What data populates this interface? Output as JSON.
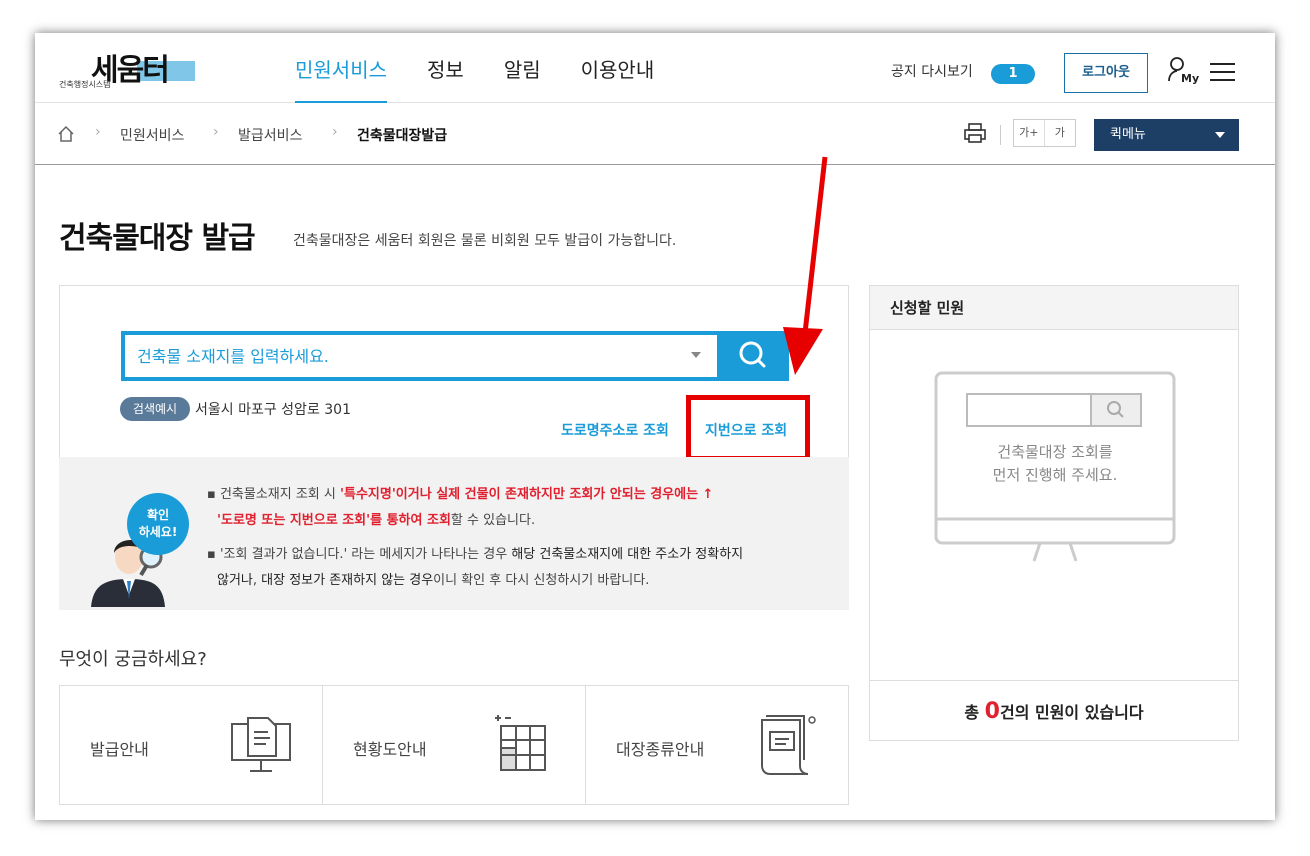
{
  "header": {
    "logo_text": "세움터",
    "logo_sub": "건축행정시스템",
    "nav": [
      {
        "label": "민원서비스"
      },
      {
        "label": "정보"
      },
      {
        "label": "알림"
      },
      {
        "label": "이용안내"
      }
    ],
    "notice_label": "공지 다시보기",
    "notice_count": "1",
    "logout_label": "로그아웃",
    "my_label": "My"
  },
  "breadcrumb": {
    "items": [
      "민원서비스",
      "발급서비스",
      "건축물대장발급"
    ]
  },
  "toolbar": {
    "font_up": "가+",
    "font_down": "가",
    "quick_menu": "퀵메뉴"
  },
  "page": {
    "title": "건축물대장 발급",
    "desc": "건축물대장은 세움터 회원은 물론 비회원 모두 발급이 가능합니다."
  },
  "search": {
    "placeholder": "건축물 소재지를 입력하세요.",
    "example_badge": "검색예시",
    "example_text": "서울시 마포구 성암로 301",
    "road_link": "도로명주소로 조회",
    "jibun_link": "지번으로 조회"
  },
  "info": {
    "bubble_line1": "확인",
    "bubble_line2": "하세요!",
    "l1_a": "건축물소재지 조회 시 ",
    "l1_b": "'특수지명'이거나 실제 건물이 존재하지만 조회가 안되는 경우에는 ↑",
    "l2_a": "'도로명 또는 지번으로 조회'를 통하여 조회",
    "l2_b": "할 수 있습니다.",
    "l3_a": "'조회 결과가 없습니다.' 라는 메세지가 나타나는 경우 ",
    "l3_b": "해당 건축물소재지에 대한 주소가 정확하지",
    "l4_a": "않거나",
    "l4_b": ", ",
    "l4_c": "대장 정보가 존재하지 않는 경우",
    "l4_d": "이니 확인 후 다시 신청하시기 바랍니다."
  },
  "faq": {
    "title": "무엇이 궁금하세요?",
    "cards": [
      {
        "label": "발급안내",
        "icon": "monitor-document-icon"
      },
      {
        "label": "현황도안내",
        "icon": "grid-plan-icon"
      },
      {
        "label": "대장종류안내",
        "icon": "scroll-chat-icon"
      }
    ]
  },
  "apply": {
    "title": "신청할 민원",
    "msg_line1": "건축물대장 조회를",
    "msg_line2": "먼저 진행해 주세요.",
    "total_prefix": "총 ",
    "total_count": "0",
    "total_suffix": "건의 민원이 있습니다"
  },
  "colors": {
    "accent": "#1a9cd8",
    "navy": "#1d3f66",
    "highlight_red": "#e60000"
  }
}
